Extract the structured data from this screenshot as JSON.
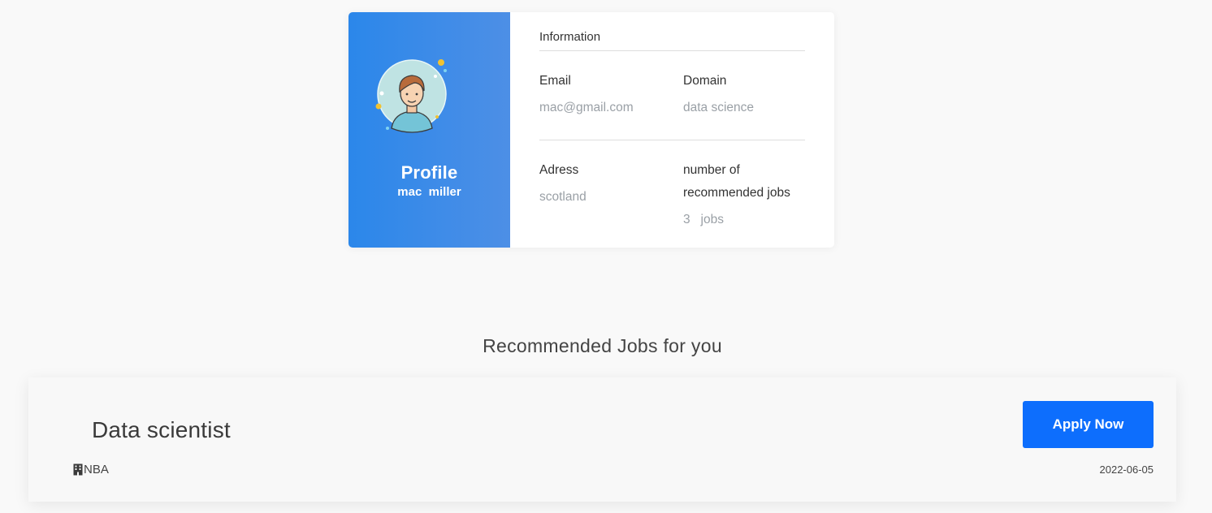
{
  "profile": {
    "title": "Profile",
    "name": "mac  miller"
  },
  "info": {
    "heading": "Information",
    "email_label": "Email",
    "email_value": "mac@gmail.com",
    "domain_label": "Domain",
    "domain_value": "data science",
    "address_label": "Adress",
    "address_value": "scotland",
    "jobs_count_label": "number of recommended jobs",
    "jobs_count_value": "3   jobs"
  },
  "recommended": {
    "heading": "Recommended Jobs for you",
    "jobs": [
      {
        "title": "Data scientist",
        "company": "NBA",
        "date": "2022-06-05",
        "apply_label": "Apply Now",
        "company_icon": "building-icon"
      }
    ]
  },
  "colors": {
    "profile_gradient_start": "#2b87ea",
    "profile_gradient_end": "#4d8fe6",
    "apply_button": "#0d6efd",
    "page_background": "#f9f9f9"
  }
}
